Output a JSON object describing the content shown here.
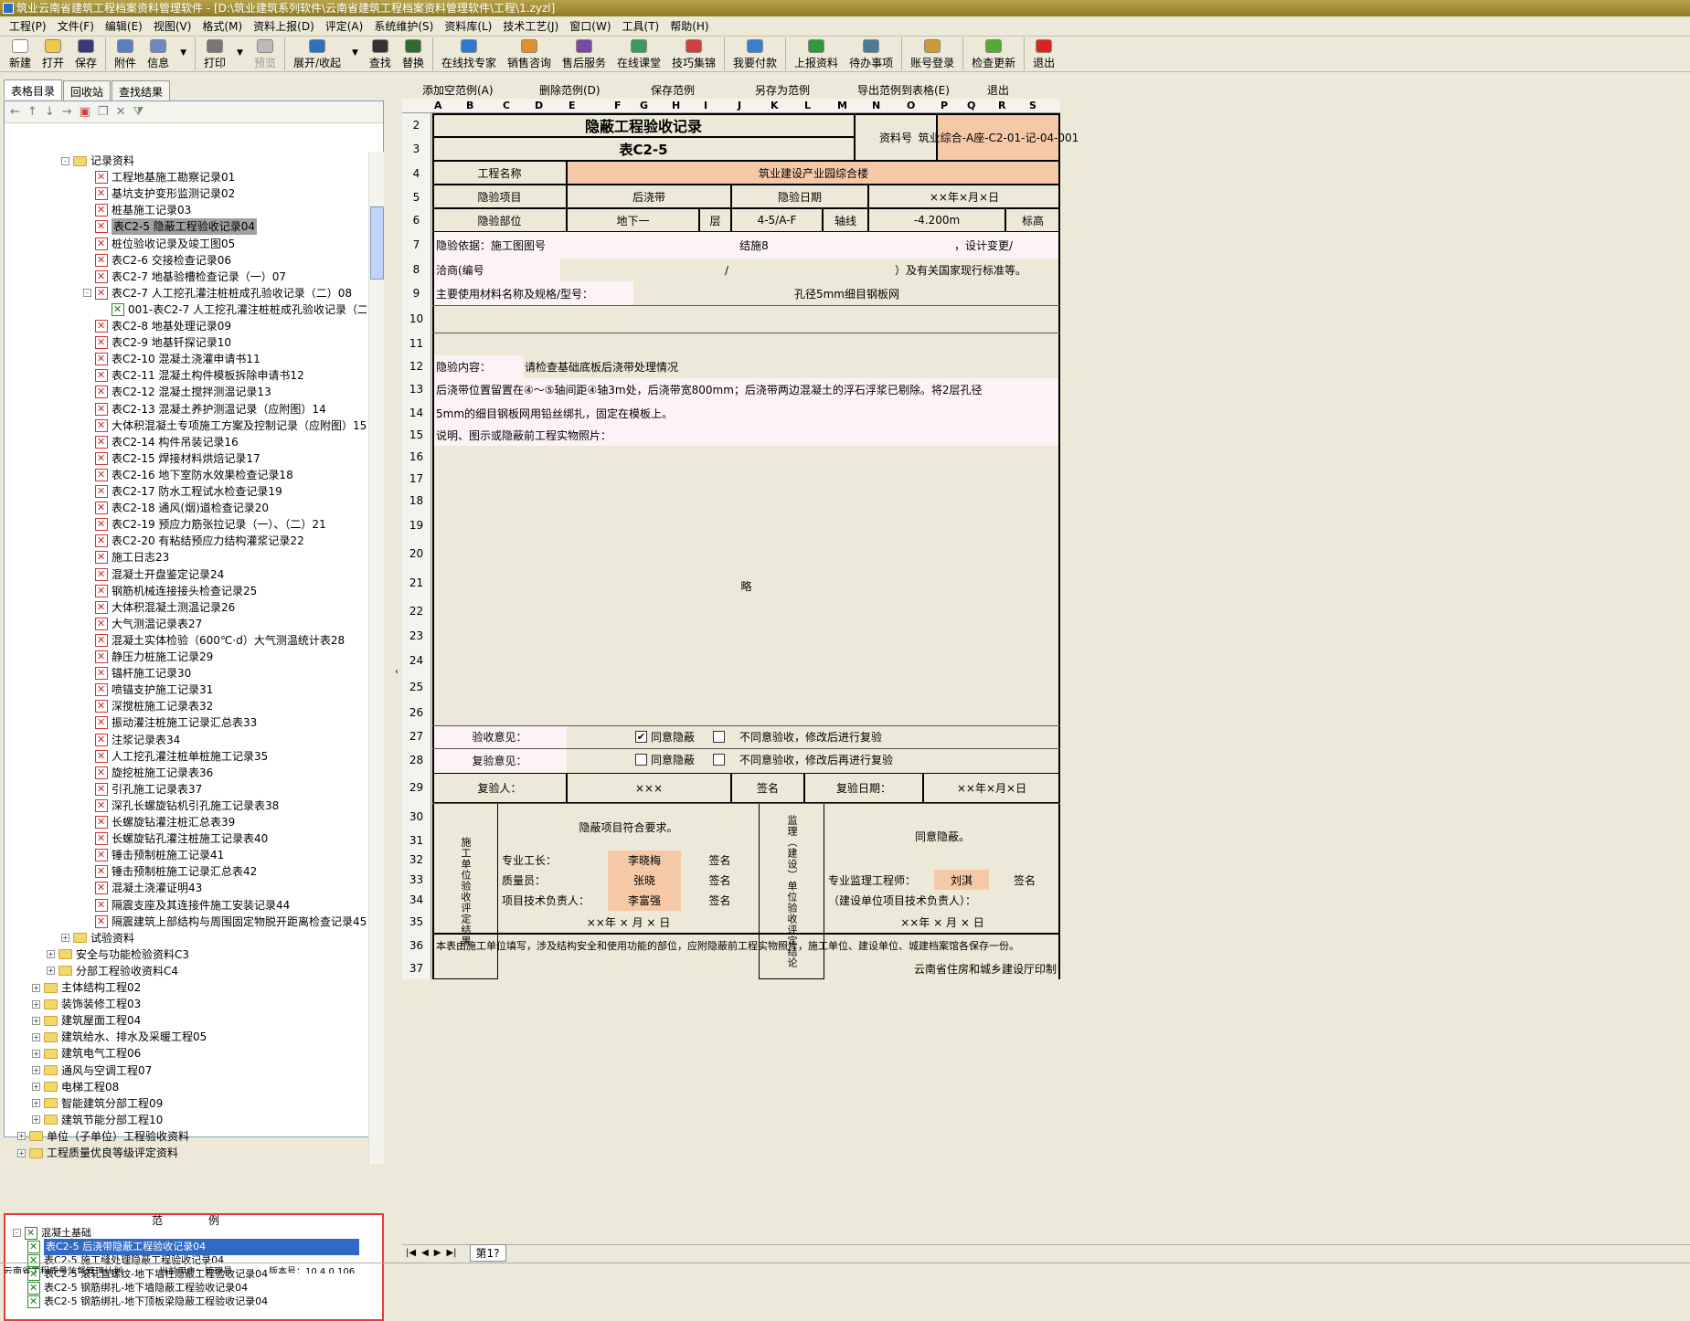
{
  "window": {
    "title": "筑业云南省建筑工程档案资料管理软件 - [D:\\筑业建筑系列软件\\云南省建筑工程档案资料管理软件\\工程\\1.zyzl]"
  },
  "menu": [
    "工程(P)",
    "文件(F)",
    "编辑(E)",
    "视图(V)",
    "格式(M)",
    "资料上报(D)",
    "评定(A)",
    "系统维护(S)",
    "资料库(L)",
    "技术工艺(J)",
    "窗口(W)",
    "工具(T)",
    "帮助(H)"
  ],
  "toolbar": [
    {
      "label": "新建",
      "icon": "new-file-icon",
      "color": "#ffffff"
    },
    {
      "label": "打开",
      "icon": "open-folder-icon",
      "color": "#f0c94a"
    },
    {
      "label": "保存",
      "icon": "save-icon",
      "color": "#3a3a7a"
    },
    {
      "label": "附件",
      "icon": "attachment-icon",
      "color": "#5a7fc0"
    },
    {
      "label": "信息",
      "icon": "info-icon",
      "color": "#6a8ac0"
    },
    {
      "label": "打印",
      "icon": "printer-icon",
      "color": "#777777"
    },
    {
      "label": "预览",
      "icon": "preview-icon",
      "color": "#bbbbbb"
    },
    {
      "label": "展开/收起",
      "icon": "expand-collapse-icon",
      "color": "#3070c0"
    },
    {
      "label": "查找",
      "icon": "binoculars-icon",
      "color": "#333333"
    },
    {
      "label": "替换",
      "icon": "replace-icon",
      "color": "#2f6a2f"
    },
    {
      "label": "在线找专家",
      "icon": "expert-icon",
      "color": "#2d7ad6"
    },
    {
      "label": "销售咨询",
      "icon": "sales-icon",
      "color": "#e0902a"
    },
    {
      "label": "售后服务",
      "icon": "service-icon",
      "color": "#7a4aa0"
    },
    {
      "label": "在线课堂",
      "icon": "classroom-icon",
      "color": "#3a9a5a"
    },
    {
      "label": "技巧集锦",
      "icon": "tips-icon",
      "color": "#d04040"
    },
    {
      "label": "我要付款",
      "icon": "payment-icon",
      "color": "#3a80d0"
    },
    {
      "label": "上报资料",
      "icon": "upload-icon",
      "color": "#2f9a3a"
    },
    {
      "label": "待办事项",
      "icon": "todo-icon",
      "color": "#4a7a9a"
    },
    {
      "label": "账号登录",
      "icon": "login-icon",
      "color": "#cc9a30"
    },
    {
      "label": "检查更新",
      "icon": "update-icon",
      "color": "#55aa33"
    },
    {
      "label": "退出",
      "icon": "exit-icon",
      "color": "#dd2222"
    }
  ],
  "left": {
    "tabs": [
      "表格目录",
      "回收站",
      "查找结果"
    ],
    "tree": [
      {
        "t": "记录资料",
        "lv": 0,
        "k": "fold",
        "e": "-"
      },
      {
        "t": "工程地基施工勘察记录01",
        "lv": 1,
        "k": "x"
      },
      {
        "t": "基坑支护变形监测记录02",
        "lv": 1,
        "k": "x"
      },
      {
        "t": "桩基施工记录03",
        "lv": 1,
        "k": "x"
      },
      {
        "t": "表C2-5 隐蔽工程验收记录04",
        "lv": 1,
        "k": "x",
        "sel": true
      },
      {
        "t": "桩位验收记录及竣工图05",
        "lv": 1,
        "k": "x"
      },
      {
        "t": "表C2-6 交接检查记录06",
        "lv": 1,
        "k": "x"
      },
      {
        "t": "表C2-7 地基验槽检查记录（一）07",
        "lv": 1,
        "k": "x"
      },
      {
        "t": "表C2-7 人工挖孔灌注桩桩成孔验收记录（二）08",
        "lv": 1,
        "k": "x",
        "e": "-"
      },
      {
        "t": "001-表C2-7 人工挖孔灌注桩桩成孔验收记录（二",
        "lv": 2,
        "k": "g"
      },
      {
        "t": "表C2-8 地基处理记录09",
        "lv": 1,
        "k": "x"
      },
      {
        "t": "表C2-9 地基钎探记录10",
        "lv": 1,
        "k": "x"
      },
      {
        "t": "表C2-10 混凝土浇灌申请书11",
        "lv": 1,
        "k": "x"
      },
      {
        "t": "表C2-11 混凝土构件模板拆除申请书12",
        "lv": 1,
        "k": "x"
      },
      {
        "t": "表C2-12 混凝土搅拌测温记录13",
        "lv": 1,
        "k": "x"
      },
      {
        "t": "表C2-13 混凝土养护测温记录（应附图）14",
        "lv": 1,
        "k": "x"
      },
      {
        "t": "大体积混凝土专项施工方案及控制记录（应附图）15",
        "lv": 1,
        "k": "x"
      },
      {
        "t": "表C2-14 构件吊装记录16",
        "lv": 1,
        "k": "x"
      },
      {
        "t": "表C2-15 焊接材料烘焙记录17",
        "lv": 1,
        "k": "x"
      },
      {
        "t": "表C2-16 地下室防水效果检查记录18",
        "lv": 1,
        "k": "x"
      },
      {
        "t": "表C2-17 防水工程试水检查记录19",
        "lv": 1,
        "k": "x"
      },
      {
        "t": "表C2-18 通风(烟)道检查记录20",
        "lv": 1,
        "k": "x"
      },
      {
        "t": "表C2-19 预应力筋张拉记录（一）、（二）21",
        "lv": 1,
        "k": "x"
      },
      {
        "t": "表C2-20 有粘结预应力结构灌浆记录22",
        "lv": 1,
        "k": "x"
      },
      {
        "t": "施工日志23",
        "lv": 1,
        "k": "x"
      },
      {
        "t": "混凝土开盘鉴定记录24",
        "lv": 1,
        "k": "x"
      },
      {
        "t": "钢筋机械连接接头检查记录25",
        "lv": 1,
        "k": "x"
      },
      {
        "t": "大体积混凝土测温记录26",
        "lv": 1,
        "k": "x"
      },
      {
        "t": "大气测温记录表27",
        "lv": 1,
        "k": "x"
      },
      {
        "t": "混凝土实体检验（600℃·d）大气测温统计表28",
        "lv": 1,
        "k": "x"
      },
      {
        "t": "静压力桩施工记录29",
        "lv": 1,
        "k": "x"
      },
      {
        "t": "锚杆施工记录30",
        "lv": 1,
        "k": "x"
      },
      {
        "t": "喷锚支护施工记录31",
        "lv": 1,
        "k": "x"
      },
      {
        "t": "深搅桩施工记录表32",
        "lv": 1,
        "k": "x"
      },
      {
        "t": "振动灌注桩施工记录汇总表33",
        "lv": 1,
        "k": "x"
      },
      {
        "t": "注浆记录表34",
        "lv": 1,
        "k": "x"
      },
      {
        "t": "人工挖孔灌注桩单桩施工记录35",
        "lv": 1,
        "k": "x"
      },
      {
        "t": "旋挖桩施工记录表36",
        "lv": 1,
        "k": "x"
      },
      {
        "t": "引孔施工记录表37",
        "lv": 1,
        "k": "x"
      },
      {
        "t": "深孔长螺旋钻机引孔施工记录表38",
        "lv": 1,
        "k": "x"
      },
      {
        "t": "长螺旋钻灌注桩汇总表39",
        "lv": 1,
        "k": "x"
      },
      {
        "t": "长螺旋钻孔灌注桩施工记录表40",
        "lv": 1,
        "k": "x"
      },
      {
        "t": "锤击预制桩施工记录41",
        "lv": 1,
        "k": "x"
      },
      {
        "t": "锤击预制桩施工记录汇总表42",
        "lv": 1,
        "k": "x"
      },
      {
        "t": "混凝土浇灌证明43",
        "lv": 1,
        "k": "x"
      },
      {
        "t": "隔震支座及其连接件施工安装记录44",
        "lv": 1,
        "k": "x"
      },
      {
        "t": "隔震建筑上部结构与周围固定物脱开距离检查记录45",
        "lv": 1,
        "k": "x"
      },
      {
        "t": "试验资料",
        "lv": 0,
        "k": "fold",
        "e": "+"
      },
      {
        "t": "安全与功能检验资料C3",
        "lv": -1,
        "k": "fold",
        "e": "+"
      },
      {
        "t": "分部工程验收资料C4",
        "lv": -1,
        "k": "fold",
        "e": "+"
      },
      {
        "t": "主体结构工程02",
        "lv": -2,
        "k": "fold",
        "e": "+"
      },
      {
        "t": "装饰装修工程03",
        "lv": -2,
        "k": "fold",
        "e": "+"
      },
      {
        "t": "建筑屋面工程04",
        "lv": -2,
        "k": "fold",
        "e": "+"
      },
      {
        "t": "建筑给水、排水及采暖工程05",
        "lv": -2,
        "k": "fold",
        "e": "+"
      },
      {
        "t": "建筑电气工程06",
        "lv": -2,
        "k": "fold",
        "e": "+"
      },
      {
        "t": "通风与空调工程07",
        "lv": -2,
        "k": "fold",
        "e": "+"
      },
      {
        "t": "电梯工程08",
        "lv": -2,
        "k": "fold",
        "e": "+"
      },
      {
        "t": "智能建筑分部工程09",
        "lv": -2,
        "k": "fold",
        "e": "+"
      },
      {
        "t": "建筑节能分部工程10",
        "lv": -2,
        "k": "fold",
        "e": "+"
      },
      {
        "t": "单位（子单位）工程验收资料",
        "lv": -3,
        "k": "fold",
        "e": "+"
      },
      {
        "t": "工程质量优良等级评定资料",
        "lv": -3,
        "k": "fold",
        "e": "+"
      }
    ],
    "sample_header": [
      "范",
      "例"
    ],
    "samples": [
      {
        "t": "混凝土基础",
        "lv": 0
      },
      {
        "t": "表C2-5 后浇带隐蔽工程验收记录04",
        "lv": 1,
        "sel": true
      },
      {
        "t": "表C2-5 施工缝处理隐蔽工程验收记录04",
        "lv": 1
      },
      {
        "t": "表C2-5 滚轧直螺纹-地下墙柱隐蔽工程验收记录04",
        "lv": 1
      },
      {
        "t": "表C2-5 钢筋绑扎-地下墙隐蔽工程验收记录04",
        "lv": 1
      },
      {
        "t": "表C2-5 钢筋绑扎-地下顶板梁隐蔽工程验收记录04",
        "lv": 1
      }
    ]
  },
  "right": {
    "actions": [
      "添加空范例(A)",
      "删除范例(D)",
      "保存范例",
      "另存为范例",
      "导出范例到表格(E)",
      "退出"
    ],
    "columns": [
      "A",
      "B",
      "C",
      "D",
      "E",
      "F",
      "G",
      "H",
      "I",
      "J",
      "K",
      "L",
      "M",
      "N",
      "O",
      "P",
      "Q",
      "R",
      "S"
    ],
    "sheet_tab": "第1?",
    "form": {
      "title": "隐蔽工程验收记录",
      "subtitle": "表C2-5",
      "doc_no_label": "资料号",
      "doc_no": "筑业综合-A座-C2-01-记-04-001",
      "project_label": "工程名称",
      "project": "筑业建设产业园综合楼",
      "item_label": "隐验项目",
      "item": "后浇带",
      "date_label": "隐验日期",
      "date": "××年×月×日",
      "part_label": "隐验部位",
      "part": "地下一",
      "floor_label": "层",
      "axis": "4-5/A-F",
      "axis_label": "轴线",
      "elev": "-4.200m",
      "elev_label": "标高",
      "basis_label": "隐验依据：施工图图号",
      "basis": "结施8",
      "basis_tail": "，设计变更/",
      "nego_label": "洽商(编号",
      "nego": "/",
      "nego_tail": "）及有关国家现行标准等。",
      "material_label": "主要使用材料名称及规格/型号：",
      "material": "孔径5mm细目钢板网",
      "content_label": "隐验内容：",
      "content1": "请检查基础底板后浇带处理情况",
      "content2": "后浇带位置留置在④～⑤轴间距④轴3m处，后浇带宽800mm；后浇带两边混凝土的浮石浮浆已剔除。将2层孔径",
      "content3": "5mm的细目钢板网用铅丝绑扎，固定在模板上。",
      "photo_label": "说明、图示或隐蔽前工程实物照片：",
      "photo_note": "略",
      "accept_label": "验收意见：",
      "agree": "同意隐蔽",
      "disagree": "不同意验收，修改后进行复验",
      "recheck_label": "复验意见：",
      "agree2": "同意隐蔽",
      "disagree2": "不同意验收，修改后再进行复验",
      "rechecker_label": "复验人：",
      "rechecker": "×××",
      "sign": "签名",
      "recheck_date_label": "复验日期：",
      "recheck_date": "××年×月×日",
      "builder_label": "施工单位验收评定结果",
      "builder_result": "隐蔽项目符合要求。",
      "foreman_label": "专业工长：",
      "foreman": "李晓梅",
      "qc_label": "质量员：",
      "qc": "张晓",
      "tech_label": "项目技术负责人：",
      "tech": "李富强",
      "builder_date": "××年 × 月 × 日",
      "sup_label": "监理（建设）单位验收评定结论",
      "sup_result": "同意隐蔽。",
      "sup_eng_label": "专业监理工程师：",
      "sup_eng": "刘淇",
      "owner_label": "（建设单位项目技术负责人）：",
      "sup_date": "××年 × 月 × 日",
      "note": "本表由施工单位填写，涉及结构安全和使用功能的部位，应附隐蔽前工程实物照片，施工单位、建设单位、城建档案馆各保存一份。",
      "printer": "云南省住房和城乡建设厅印制"
    },
    "rows": [
      "2",
      "3",
      "4",
      "5",
      "6",
      "7",
      "8",
      "9",
      "10",
      "11",
      "12",
      "13",
      "14",
      "15",
      "16",
      "17",
      "18",
      "19",
      "20",
      "21",
      "22",
      "23",
      "24",
      "25",
      "26",
      "27",
      "28",
      "29",
      "30",
      "31",
      "32",
      "33",
      "34",
      "35",
      "36",
      "37"
    ]
  },
  "status": [
    "云南省工程质量监督管理计划",
    "当前用户：管理员",
    "版本号：10.4.0.106"
  ]
}
